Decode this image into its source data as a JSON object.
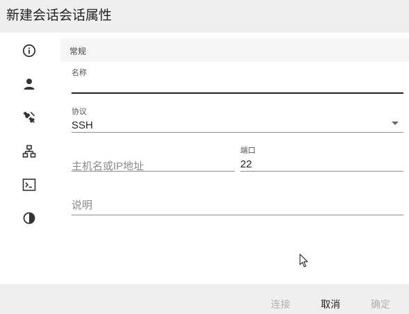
{
  "dialog": {
    "title": "新建会话会话属性"
  },
  "sidebar": {
    "items": [
      {
        "name": "info-icon",
        "label": "常规"
      },
      {
        "name": "user-icon"
      },
      {
        "name": "connection-plug-icon"
      },
      {
        "name": "network-tree-icon"
      },
      {
        "name": "terminal-icon"
      },
      {
        "name": "contrast-icon"
      }
    ]
  },
  "section": {
    "title": "常规"
  },
  "form": {
    "name": {
      "label": "名称",
      "value": ""
    },
    "protocol": {
      "label": "协议",
      "value": "SSH"
    },
    "host": {
      "placeholder": "主机名或IP地址",
      "value": ""
    },
    "port": {
      "label": "端口",
      "value": "22"
    },
    "description": {
      "placeholder": "说明",
      "value": ""
    }
  },
  "footer": {
    "connect_label": "连接",
    "cancel_label": "取消",
    "ok_label": "确定"
  }
}
